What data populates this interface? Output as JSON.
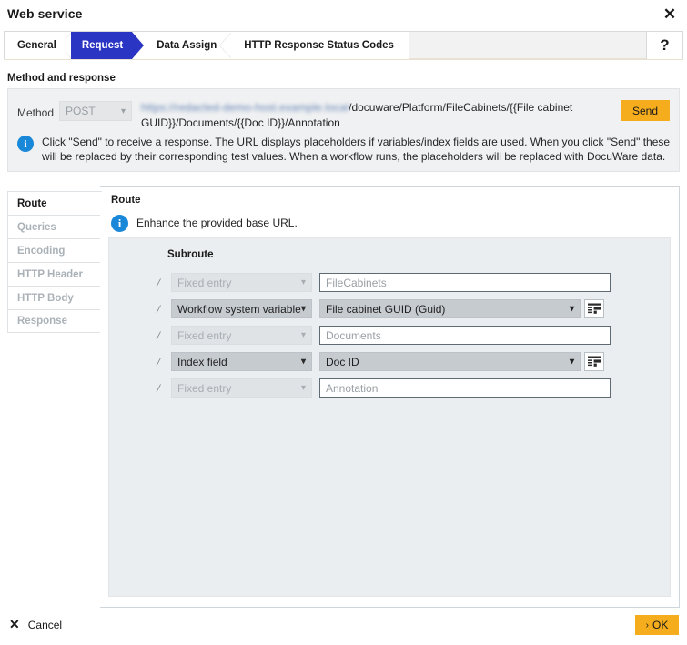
{
  "window": {
    "title": "Web service",
    "close_icon": "close-icon"
  },
  "tabstrip": {
    "tabs": [
      {
        "label": "General",
        "active": false
      },
      {
        "label": "Request",
        "active": true
      },
      {
        "label": "Data Assign",
        "active": false
      },
      {
        "label": "HTTP Response Status Codes",
        "active": false
      }
    ],
    "help_label": "?",
    "active_color": "#2b35c4"
  },
  "method_response": {
    "section_label": "Method and response",
    "method_label": "Method",
    "method_value": "POST",
    "url_redacted": "https://redacted-demo-host.example.local",
    "url_visible": "/docuware/Platform/FileCabinets/{{File cabinet GUID}}/Documents/{{Doc ID}}/Annotation",
    "send_label": "Send",
    "info_icon": "info-icon",
    "info_text": "Click \"Send\" to receive a response. The URL displays placeholders if variables/index fields are used. When you click \"Send\" these will be replaced by their corresponding test values. When a workflow runs, the placeholders will be replaced with DocuWare data."
  },
  "sidebar": {
    "items": [
      {
        "label": "Route",
        "active": true
      },
      {
        "label": "Queries",
        "active": false
      },
      {
        "label": "Encoding",
        "active": false
      },
      {
        "label": "HTTP Header",
        "active": false
      },
      {
        "label": "HTTP Body",
        "active": false
      },
      {
        "label": "Response",
        "active": false
      }
    ]
  },
  "panel": {
    "title": "Route",
    "info_icon": "info-icon",
    "info_text": "Enhance the provided base URL.",
    "subroute_title": "Subroute",
    "separator": "/",
    "rows": [
      {
        "type_value": "Fixed entry",
        "type_enabled": false,
        "value": "FileCabinets",
        "value_control": "text",
        "has_aux_button": false
      },
      {
        "type_value": "Workflow system variable",
        "type_enabled": true,
        "value": "File cabinet GUID   (Guid)",
        "value_control": "select",
        "has_aux_button": true
      },
      {
        "type_value": "Fixed entry",
        "type_enabled": false,
        "value": "Documents",
        "value_control": "text",
        "has_aux_button": false
      },
      {
        "type_value": "Index field",
        "type_enabled": true,
        "value": "Doc ID",
        "value_control": "select",
        "has_aux_button": true
      },
      {
        "type_value": "Fixed entry",
        "type_enabled": false,
        "value": "Annotation",
        "value_control": "text",
        "has_aux_button": false
      }
    ]
  },
  "footer": {
    "cancel_label": "Cancel",
    "cancel_icon": "close-icon",
    "ok_label": "OK",
    "ok_chevron": "›",
    "ok_color": "#f5ac1d"
  }
}
